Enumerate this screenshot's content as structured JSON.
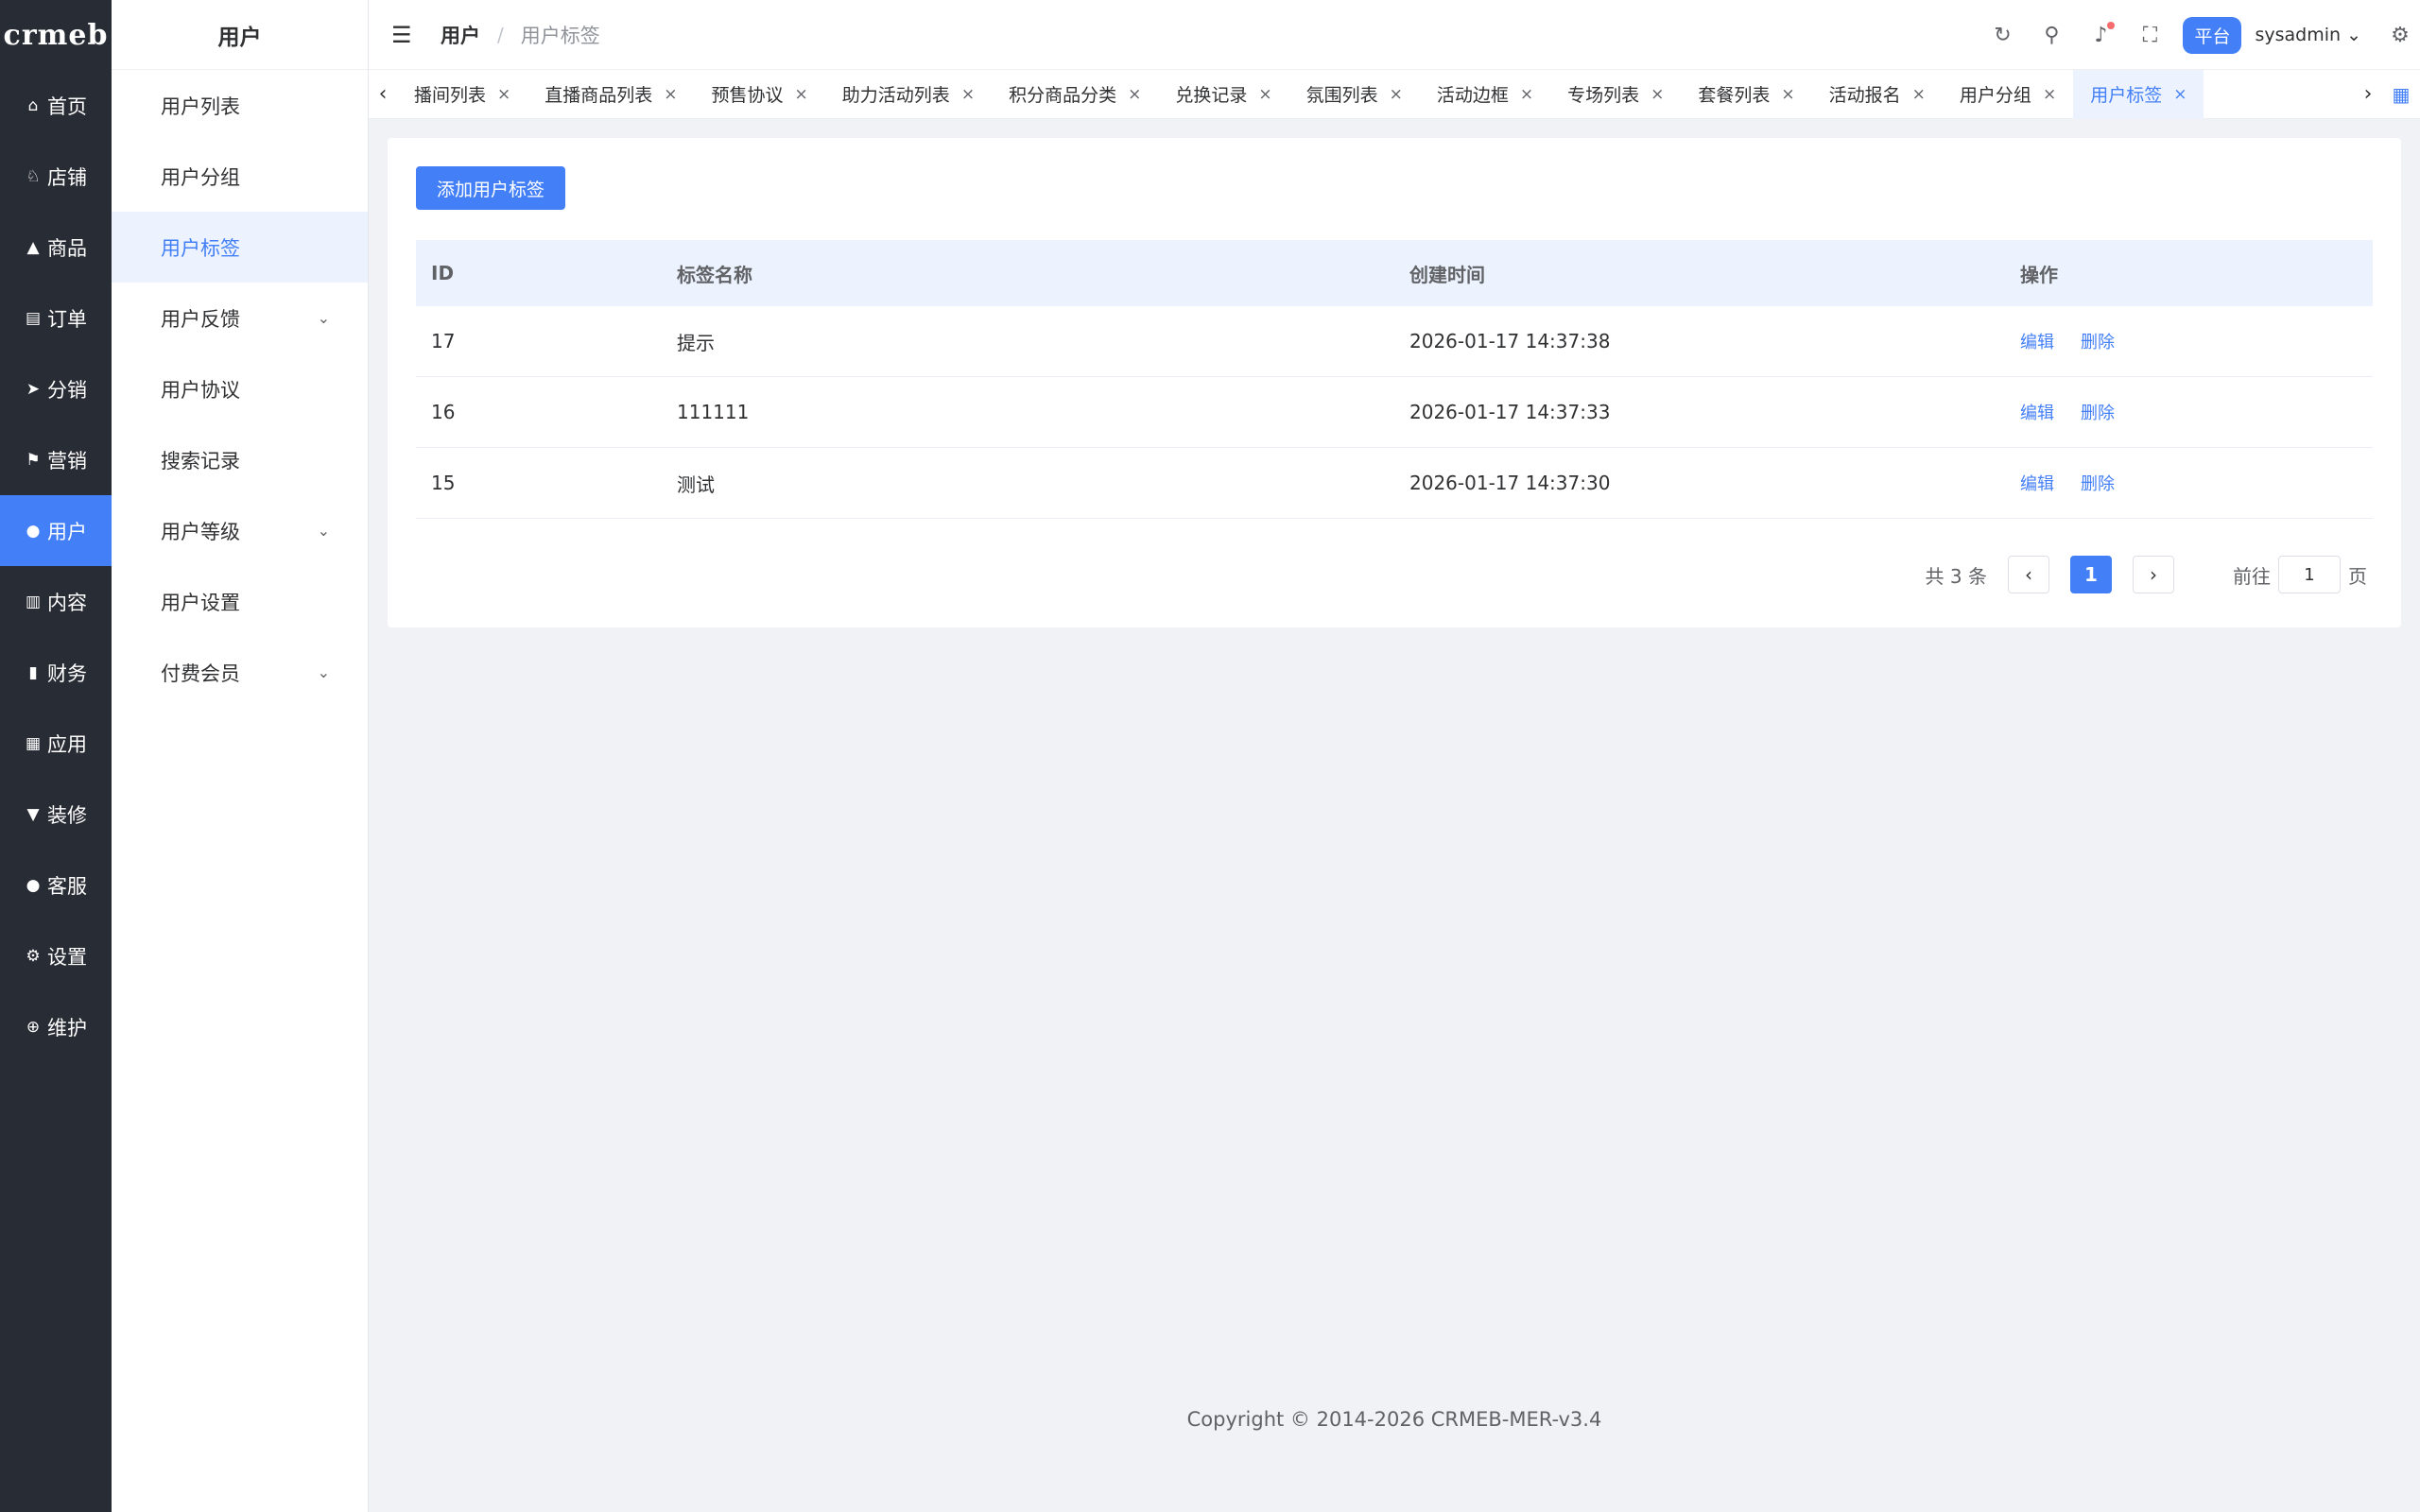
{
  "logo": "crmeb",
  "nav": {
    "items": [
      {
        "label": "首页",
        "icon": "home-icon",
        "glyph": "⌂"
      },
      {
        "label": "店铺",
        "icon": "store-icon",
        "glyph": "♘"
      },
      {
        "label": "商品",
        "icon": "bag-icon",
        "glyph": "▲"
      },
      {
        "label": "订单",
        "icon": "clipboard-icon",
        "glyph": "▤"
      },
      {
        "label": "分销",
        "icon": "send-icon",
        "glyph": "➤"
      },
      {
        "label": "营销",
        "icon": "flag-icon",
        "glyph": "⚑"
      },
      {
        "label": "用户",
        "icon": "user-icon",
        "glyph": "●"
      },
      {
        "label": "内容",
        "icon": "book-icon",
        "glyph": "▥"
      },
      {
        "label": "财务",
        "icon": "chart-icon",
        "glyph": "▮"
      },
      {
        "label": "应用",
        "icon": "apps-icon",
        "glyph": "▦"
      },
      {
        "label": "装修",
        "icon": "brush-icon",
        "glyph": "▼"
      },
      {
        "label": "客服",
        "icon": "service-icon",
        "glyph": "●"
      },
      {
        "label": "设置",
        "icon": "gear-icon",
        "glyph": "⚙"
      },
      {
        "label": "维护",
        "icon": "maintain-icon",
        "glyph": "⊕"
      }
    ],
    "active_index": 6
  },
  "submenu": {
    "title": "用户",
    "items": [
      {
        "label": "用户列表",
        "has_children": false
      },
      {
        "label": "用户分组",
        "has_children": false
      },
      {
        "label": "用户标签",
        "has_children": false
      },
      {
        "label": "用户反馈",
        "has_children": true
      },
      {
        "label": "用户协议",
        "has_children": false
      },
      {
        "label": "搜索记录",
        "has_children": false
      },
      {
        "label": "用户等级",
        "has_children": true
      },
      {
        "label": "用户设置",
        "has_children": false
      },
      {
        "label": "付费会员",
        "has_children": true
      }
    ],
    "active_index": 2
  },
  "header": {
    "breadcrumb_root": "用户",
    "breadcrumb_sep": "/",
    "breadcrumb_current": "用户标签",
    "platform_badge": "平台",
    "username": "sysadmin"
  },
  "tabs": {
    "items": [
      "播间列表",
      "直播商品列表",
      "预售协议",
      "助力活动列表",
      "积分商品分类",
      "兑换记录",
      "氛围列表",
      "活动边框",
      "专场列表",
      "套餐列表",
      "活动报名",
      "用户分组",
      "用户标签"
    ],
    "active_index": 12
  },
  "page": {
    "add_button": "添加用户标签",
    "columns": [
      "ID",
      "标签名称",
      "创建时间",
      "操作"
    ],
    "rows": [
      {
        "id": "17",
        "name": "提示",
        "created": "2026-01-17 14:37:38"
      },
      {
        "id": "16",
        "name": "111111",
        "created": "2026-01-17 14:37:33"
      },
      {
        "id": "15",
        "name": "测试",
        "created": "2026-01-17 14:37:30"
      }
    ],
    "edit_label": "编辑",
    "delete_label": "删除",
    "pagination": {
      "total_text": "共 3 条",
      "current_page": "1",
      "goto_label": "前往",
      "goto_value": "1",
      "page_suffix": "页"
    }
  },
  "footer": "Copyright © 2014-2026 CRMEB-MER-v3.4",
  "colors": {
    "accent": "#437ff6",
    "nav_bg": "#282c34",
    "page_bg": "#f0f2f5"
  }
}
